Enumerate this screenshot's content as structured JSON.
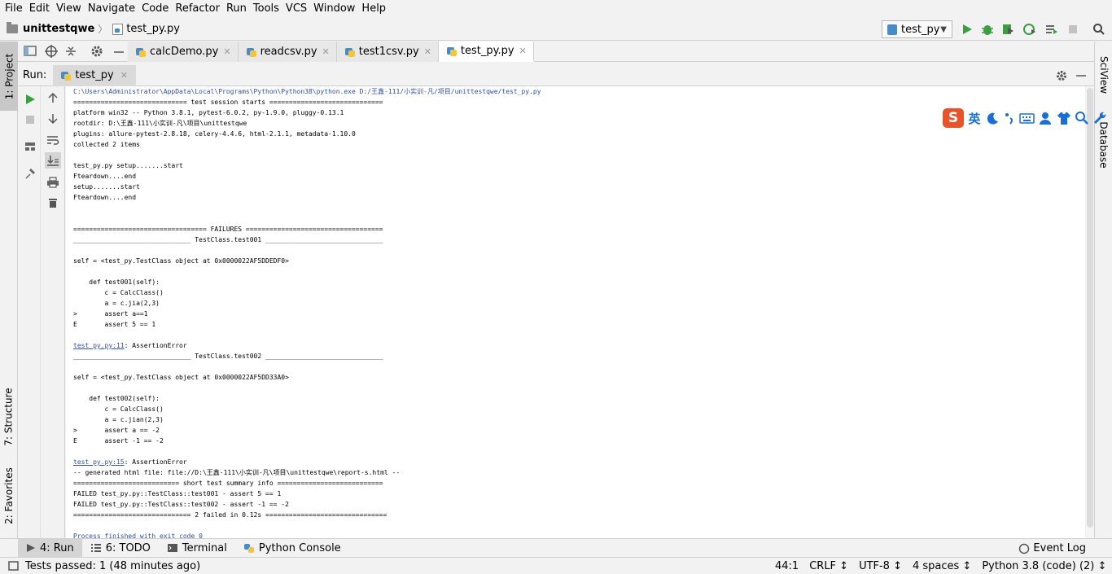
{
  "menu": [
    "File",
    "Edit",
    "View",
    "Navigate",
    "Code",
    "Refactor",
    "Run",
    "Tools",
    "VCS",
    "Window",
    "Help"
  ],
  "nav": {
    "project": "unittestqwe",
    "file": "test_py.py"
  },
  "run_config": "test_py",
  "left_tabs": {
    "project": "1: Project",
    "structure": "7: Structure",
    "favorites": "2: Favorites"
  },
  "right_tabs": {
    "sciview": "SciView",
    "database": "Database"
  },
  "editor_tabs": [
    {
      "label": "calcDemo.py"
    },
    {
      "label": "readcsv.py"
    },
    {
      "label": "test1csv.py"
    },
    {
      "label": "test_py.py",
      "active": true
    }
  ],
  "run": {
    "label": "Run:",
    "tab": "test_py"
  },
  "ime": {
    "logo": "S",
    "lang": "英"
  },
  "console_lines": [
    {
      "text": "C:\\Users\\Administrator\\AppData\\Local\\Programs\\Python\\Python38\\python.exe D:/王鑫-111/小实训-凡/项目/unittestqwe/test_py.py",
      "style": "link"
    },
    {
      "text": "============================= test session starts ============================="
    },
    {
      "text": "platform win32 -- Python 3.8.1, pytest-6.0.2, py-1.9.0, pluggy-0.13.1"
    },
    {
      "text": "rootdir: D:\\王鑫-111\\小实训-凡\\项目\\unittestqwe"
    },
    {
      "text": "plugins: allure-pytest-2.8.18, celery-4.4.6, html-2.1.1, metadata-1.10.0"
    },
    {
      "text": "collected 2 items"
    },
    {
      "text": ""
    },
    {
      "text": "test_py.py setup.......start"
    },
    {
      "text": "Fteardown....end"
    },
    {
      "text": "setup.......start"
    },
    {
      "text": "Fteardown....end"
    },
    {
      "text": ""
    },
    {
      "text": ""
    },
    {
      "text": "================================== FAILURES ==================================="
    },
    {
      "text": "______________________________ TestClass.test001 ______________________________"
    },
    {
      "text": ""
    },
    {
      "text": "self = <test_py.TestClass object at 0x0000022AF5DDEDF0>"
    },
    {
      "text": ""
    },
    {
      "text": "    def test001(self):"
    },
    {
      "text": "        c = CalcClass()"
    },
    {
      "text": "        a = c.jia(2,3)"
    },
    {
      "text": ">       assert a==1"
    },
    {
      "text": "E       assert 5 == 1"
    },
    {
      "text": ""
    },
    {
      "text": "test_py.py:11: AssertionError",
      "style": "link",
      "link_text": "test_py.py:11",
      "rest_text": ": AssertionError"
    },
    {
      "text": "______________________________ TestClass.test002 ______________________________"
    },
    {
      "text": ""
    },
    {
      "text": "self = <test_py.TestClass object at 0x0000022AF5DD33A0>"
    },
    {
      "text": ""
    },
    {
      "text": "    def test002(self):"
    },
    {
      "text": "        c = CalcClass()"
    },
    {
      "text": "        a = c.jian(2,3)"
    },
    {
      "text": ">       assert a == -2"
    },
    {
      "text": "E       assert -1 == -2"
    },
    {
      "text": ""
    },
    {
      "text": "test_py.py:15: AssertionError",
      "style": "link",
      "link_text": "test_py.py:15",
      "rest_text": ": AssertionError"
    },
    {
      "text": "-- generated html file: file://D:\\王鑫-111\\小实训-凡\\项目\\unittestqwe\\report-s.html --"
    },
    {
      "text": "=========================== short test summary info ==========================="
    },
    {
      "text": "FAILED test_py.py::TestClass::test001 - assert 5 == 1"
    },
    {
      "text": "FAILED test_py.py::TestClass::test002 - assert -1 == -2"
    },
    {
      "text": "============================== 2 failed in 0.12s ==============================="
    },
    {
      "text": ""
    },
    {
      "text": "Process finished with exit code 0",
      "style": "link"
    }
  ],
  "bottom_tabs": [
    {
      "label": "4: Run",
      "active": true,
      "icon": "play-icon"
    },
    {
      "label": "6: TODO",
      "icon": "todo-icon"
    },
    {
      "label": "Terminal",
      "icon": "terminal-icon"
    },
    {
      "label": "Python Console",
      "icon": "python-console-icon"
    }
  ],
  "event_log": "Event Log",
  "status": {
    "message": "Tests passed: 1 (48 minutes ago)",
    "position": "44:1",
    "line_sep": "CRLF ↕",
    "encoding": "UTF-8 ↕",
    "indent": "4 spaces ↕",
    "interpreter": "Python 3.8 (code) (2) ↕"
  },
  "colors": {
    "link": "#2f4fa8",
    "run_green": "#3c9e41",
    "ime_red": "#e8542a",
    "ime_blue": "#1a6fd4"
  }
}
